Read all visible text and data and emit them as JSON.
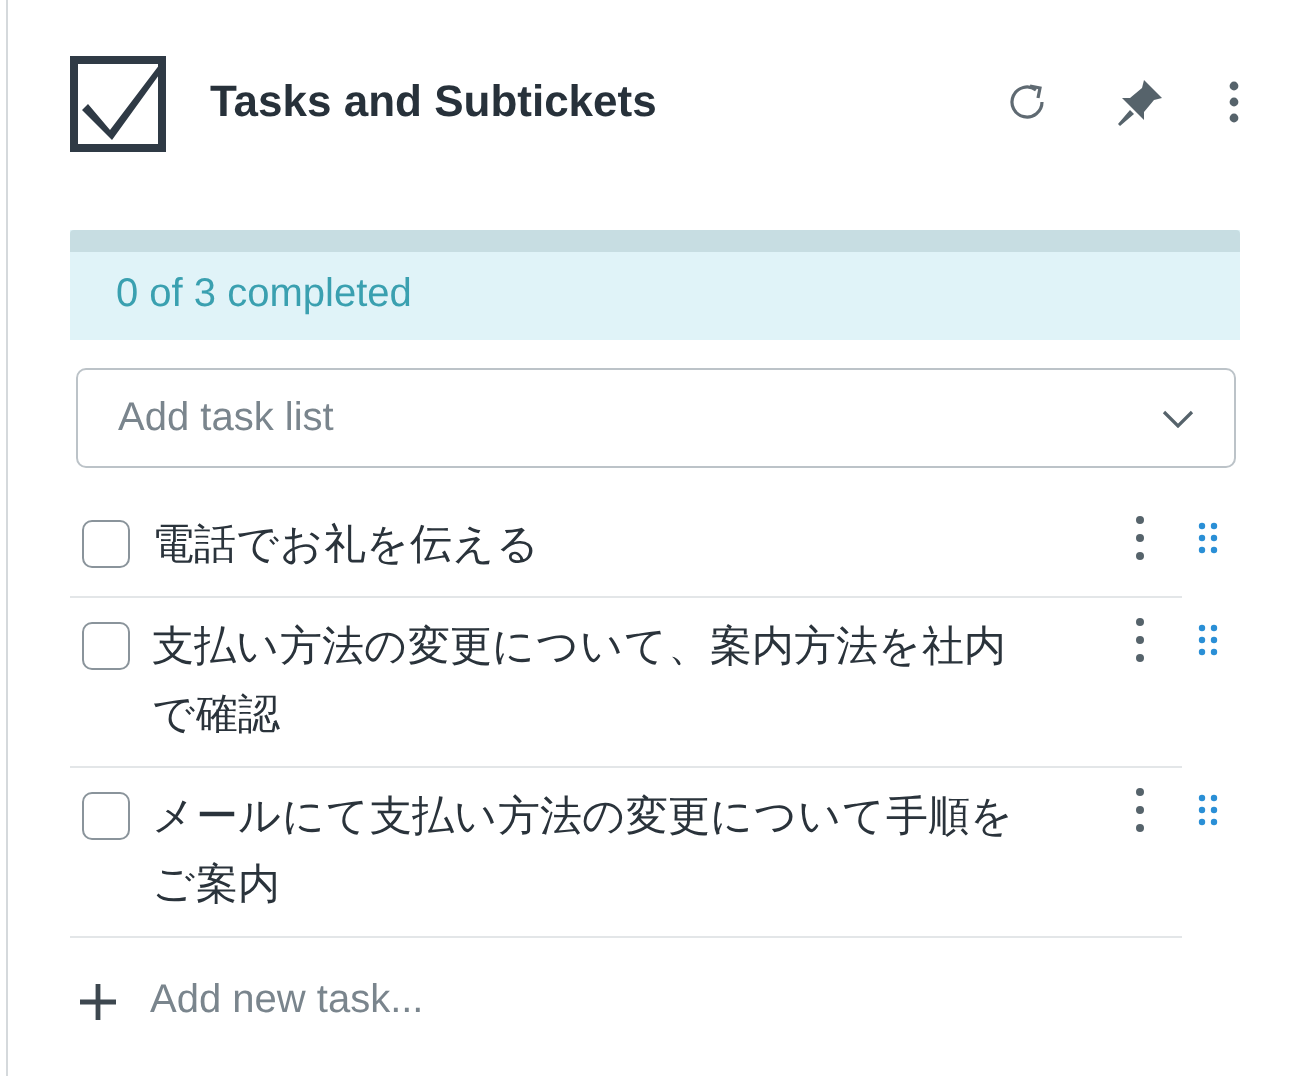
{
  "panel": {
    "title": "Tasks and Subtickets"
  },
  "progress": {
    "level": 0,
    "label": "0 of 3 completed"
  },
  "task_list_select": {
    "placeholder": "Add task list"
  },
  "tasks": [
    {
      "text": "電話でお礼を伝える",
      "checked": false
    },
    {
      "text": "支払い方法の変更について、案内方法を社内で確認",
      "checked": false
    },
    {
      "text": "メールにて支払い方法の変更について手順をご案内",
      "checked": false
    }
  ],
  "add_task": {
    "placeholder": "Add new task..."
  }
}
